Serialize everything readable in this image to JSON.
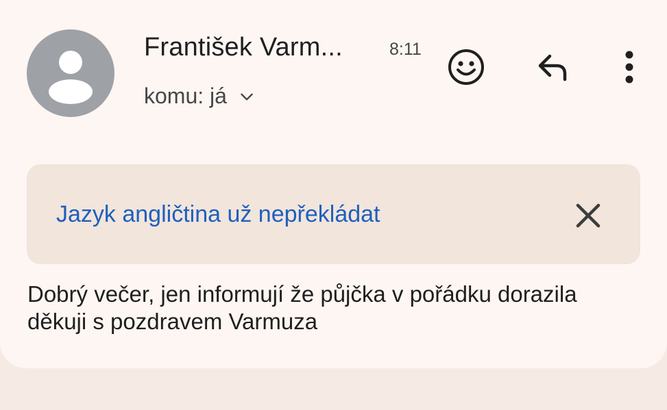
{
  "email": {
    "sender_name": "František Varm...",
    "time": "8:11",
    "recipient_label": "komu: já",
    "body": "Dobrý večer, jen informují že půjčka v pořádku dorazila děkuji s pozdravem Varmuza"
  },
  "translation_banner": {
    "link_text": "Jazyk angličtina už nepřekládat"
  },
  "icons": {
    "avatar": "person-avatar-icon",
    "recipient_toggle": "chevron-down-icon",
    "emoji": "smiley-icon",
    "reply": "reply-icon",
    "more": "more-vert-icon",
    "close": "close-icon"
  },
  "colors": {
    "page_background": "#f6ebe4",
    "card_background": "#fdf6f2",
    "banner_background": "#f1e5dc",
    "link": "#1f5fbd",
    "avatar": "#9ea1a6"
  }
}
